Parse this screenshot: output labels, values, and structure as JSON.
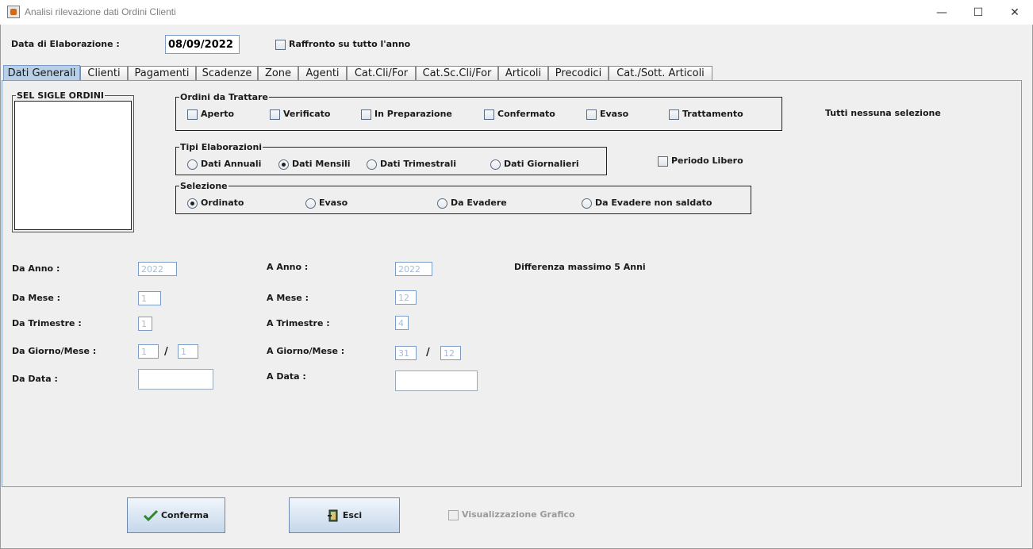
{
  "window": {
    "title": "Analisi rilevazione dati Ordini Clienti",
    "controls": {
      "minimize": "—",
      "maximize": "☐",
      "close": "✕"
    }
  },
  "header": {
    "data_label": "Data di Elaborazione :",
    "data_value": "08/09/2022",
    "raffronto_label": "Raffronto su tutto l'anno"
  },
  "tabs": [
    "Dati Generali",
    "Clienti",
    "Pagamenti",
    "Scadenze",
    "Zone",
    "Agenti",
    "Cat.Cli/For",
    "Cat.Sc.Cli/For",
    "Articoli",
    "Precodici",
    "Cat./Sott. Articoli"
  ],
  "sigle": {
    "title": "SEL SIGLE ORDINI"
  },
  "ordini": {
    "legend": "Ordini da Trattare",
    "options": [
      "Aperto",
      "Verificato",
      "In Preparazione",
      "Confermato",
      "Evaso",
      "Trattamento"
    ],
    "tutti_label": "Tutti nessuna selezione"
  },
  "tipi": {
    "legend": "Tipi Elaborazioni",
    "options": [
      "Dati Annuali",
      "Dati Mensili",
      "Dati Trimestrali",
      "Dati Giornalieri"
    ],
    "periodo_libero": "Periodo Libero"
  },
  "selezione": {
    "legend": "Selezione",
    "options": [
      "Ordinato",
      "Evaso",
      "Da Evadere",
      "Da Evadere non saldato"
    ]
  },
  "range": {
    "da_anno_label": "Da Anno :",
    "da_anno": "2022",
    "a_anno_label": "A Anno :",
    "a_anno": "2022",
    "diff_note": "Differenza massimo 5 Anni",
    "da_mese_label": "Da Mese :",
    "da_mese": "1",
    "a_mese_label": "A Mese :",
    "a_mese": "12",
    "da_trim_label": "Da Trimestre :",
    "da_trim": "1",
    "a_trim_label": "A Trimestre :",
    "a_trim": "4",
    "da_gm_label": "Da Giorno/Mese :",
    "da_giorno": "1",
    "da_mese_gm": "1",
    "a_gm_label": "A Giorno/Mese :",
    "a_giorno": "31",
    "a_mese_gm": "12",
    "slash": "/",
    "da_data_label": "Da Data :",
    "a_data_label": "A Data :"
  },
  "footer": {
    "conferma": "Conferma",
    "esci": "Esci",
    "grafico": "Visualizzazione Grafico"
  }
}
